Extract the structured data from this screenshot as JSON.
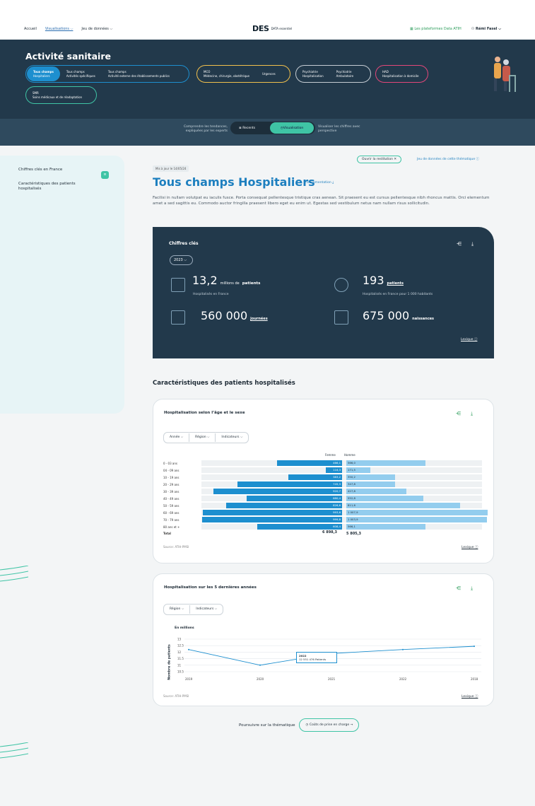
{
  "nav": {
    "home": "Accueil",
    "visualisations": "Visualisations",
    "datasets": "Jeu de données",
    "brand_main": "DES",
    "brand_small": "DATA essentiel",
    "platforms": "Les plateformes Data ATIH",
    "user": "Rémi Fasel"
  },
  "banner": {
    "title": "Activité sanitaire",
    "group1": [
      {
        "t": "Tous champs",
        "s": "Hospitaliers"
      },
      {
        "t": "Tous champs",
        "s": "Activités spécifiques"
      },
      {
        "t": "Tous champs",
        "s": "Activité externe des établissements publics"
      }
    ],
    "group2": [
      {
        "t": "MCO",
        "s": "Médecine, chirurgie, obstétrique"
      },
      {
        "t": "Urgences",
        "s": ""
      }
    ],
    "group3": [
      {
        "t": "Psychiatrie",
        "s": "Hospitalisation"
      },
      {
        "t": "Psychiatrie",
        "s": "Ambulatoire"
      }
    ],
    "group4": [
      {
        "t": "HAD",
        "s": "Hospitalisation à domicile"
      }
    ],
    "group5": [
      {
        "t": "SMR",
        "s": "Soins médicaux et de réadaptation"
      }
    ]
  },
  "subbar": {
    "left": "Comprendre les tendances, expliquées par les experts",
    "recents": "Recents",
    "visu": "Visualisation",
    "right": "Visualiser les chiffres avec perspective"
  },
  "sidebar": {
    "items": [
      "Chiffres clés en France",
      "Caractéristiques des patients hospitalisés"
    ],
    "badge": "≡"
  },
  "content": {
    "updated": "Mis à jour le 14/05/24",
    "title": "Tous champs Hospitaliers",
    "doc": "Documentation ⤓",
    "restitution": "Ouvrir la restitution ✕",
    "jeu": "Jeu de données de cette thématique ⓘ",
    "intro": "Facilisi in nullam volutpat eu iaculis fusce. Porta consequat pellentesque tristique cras aenean. Sit praesent eu est cursus pellentesque nibh rhoncus mattis. Orci elementum amet a sed sagittis eu. Commodo auctor fringilla praesent libero eget eu enim ut. Egestas sed vestibulum netus nam nullam risus sollicitudin."
  },
  "kpi": {
    "title": "Chiffres clés",
    "year": "2023 ⌵",
    "lexique": "Lexique ⓘ",
    "k1": {
      "v": "13,2",
      "u1": "millions de",
      "u2": "patients",
      "s": "Hospitalisés en France"
    },
    "k2": {
      "v": "193",
      "u2": "patients",
      "s": "Hospitalisés en France pour 1 000 habitants"
    },
    "k3": {
      "v": "560 000",
      "u2": "journées"
    },
    "k4": {
      "v": "675 000",
      "u2": "naissances"
    }
  },
  "section": "Caractéristiques des patients hospitalisés",
  "card1": {
    "title": "Hospitalisation selon l’âge et le sexe",
    "filters": [
      "Année ⌵",
      "Région ⌵",
      "Indicateurs ⌵"
    ],
    "col_f": "Femme",
    "col_h": "Homme",
    "source": "Source: ATIH-PMSI",
    "lexique": "Lexique ⓘ",
    "total_label": "Total",
    "total_f": "6 898,3",
    "total_h": "5 805,3"
  },
  "pyramid": {
    "labels": [
      "0 - 03 ans",
      "04 - 09 ans",
      "10 - 19 ans",
      "20 - 29 ans",
      "30 - 39 ans",
      "40 - 49 ans",
      "50 - 59 ans",
      "60 - 69 ans",
      "70 - 79 ans",
      "80 ans et +"
    ],
    "femme": [
      "466,1",
      "116,3",
      "383,2",
      "745,3",
      "920,7",
      "680,4",
      "826,6",
      "993,6",
      "999,8",
      "608,4"
    ],
    "homme": [
      "566,0",
      "171,5",
      "350,2",
      "347,8",
      "427,8",
      "552,8",
      "811,6",
      "1 007,9",
      "1 003,9",
      "566,1"
    ],
    "femme_num": [
      466.1,
      116.3,
      383.2,
      745.3,
      920.7,
      680.4,
      826.6,
      993.6,
      999.8,
      608.4
    ],
    "homme_num": [
      566.0,
      171.5,
      350.2,
      347.8,
      427.8,
      552.8,
      811.6,
      1007.9,
      1003.9,
      566.1
    ]
  },
  "card2": {
    "title": "Hospitalisation sur les 5 dernières années",
    "filters": [
      "Région ⌵",
      "Indicateurs ⌵"
    ],
    "unit": "En millions",
    "ylabel": "Nombre de patients",
    "source": "Source: ATIH-PMSI",
    "lexique": "Lexique ⓘ",
    "tip_year": "2022",
    "tip_val": "12 551 476",
    "tip_lbl": "Patients"
  },
  "chart_data": {
    "type": "line",
    "x": [
      "2019",
      "2020",
      "2021",
      "2022",
      "2018"
    ],
    "ylabel": "Nombre de patients",
    "ylim": [
      10.5,
      13
    ],
    "yticks": [
      "13",
      "12.5",
      "12",
      "11.5",
      "11",
      "10.5"
    ],
    "series": [
      {
        "values": [
          12.2,
          11.0,
          11.9,
          12.2,
          12.45
        ]
      }
    ]
  },
  "cta": {
    "lead": "Poursuivre sur la thématique",
    "btn": "Coûts de prise en charge →"
  }
}
